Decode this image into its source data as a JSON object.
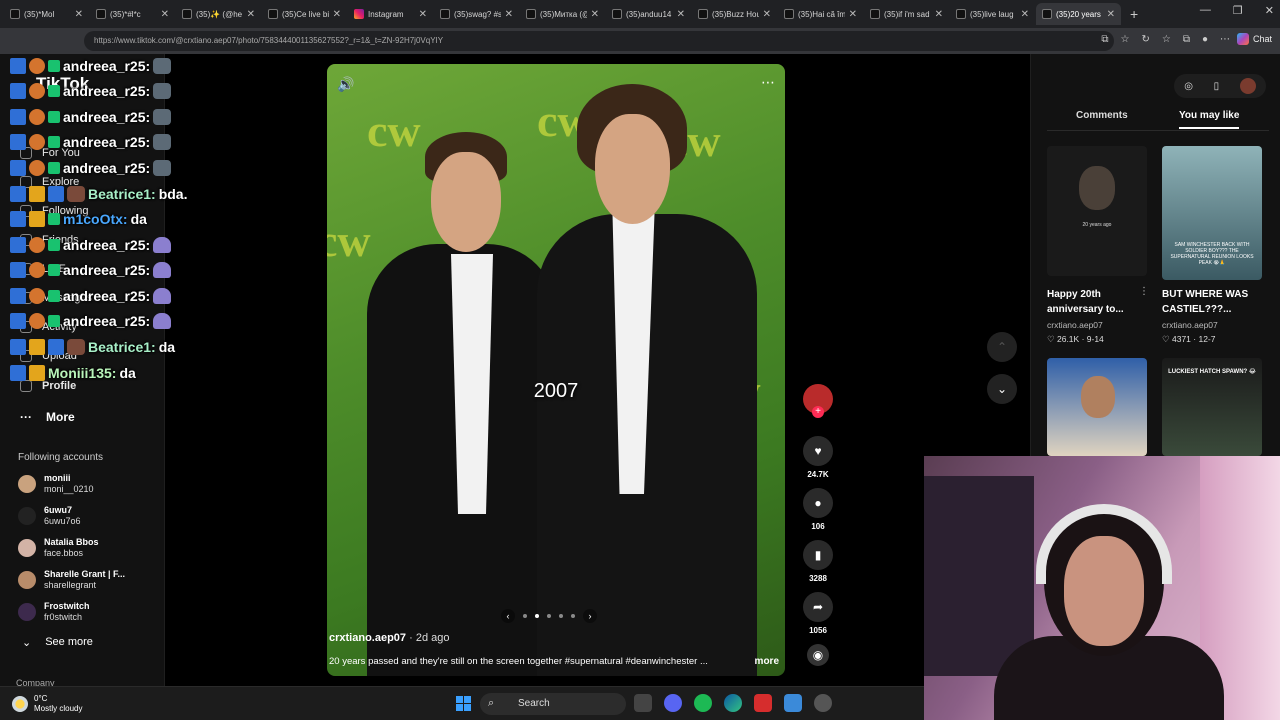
{
  "browser": {
    "tabs": [
      {
        "label": "(35)*Mol"
      },
      {
        "label": "(35)*#l*c"
      },
      {
        "label": "(35)✨ (@he"
      },
      {
        "label": "(35)Ce live bi"
      },
      {
        "label": "Instagram"
      },
      {
        "label": "(35)swag? #s"
      },
      {
        "label": "(35)Митка (@"
      },
      {
        "label": "(35)anduu14"
      },
      {
        "label": "(35)Buzz Hou"
      },
      {
        "label": "(35)Hai că îm"
      },
      {
        "label": "(35)if i'm sad"
      },
      {
        "label": "(35)live laug"
      },
      {
        "label": "(35)20 years"
      }
    ],
    "new_tab": "+",
    "url": "https://www.tiktok.com/@crxtiano.aep07/photo/7583444001135627552?_r=1&_t=ZN-92H7j0VqYIY",
    "chat_label": "Chat"
  },
  "sidebar": {
    "logo": "TikTok",
    "nav": [
      "For You",
      "Explore",
      "Following",
      "Friends",
      "LIVE",
      "Messages",
      "Activity",
      "Upload",
      "Profile"
    ],
    "more": "More",
    "following_header": "Following accounts",
    "accounts": [
      {
        "name": "moniii",
        "handle": "moni__0210"
      },
      {
        "name": "6uwu7",
        "handle": "6uwu7o6"
      },
      {
        "name": "Natalia Bbos",
        "handle": "face.bbos"
      },
      {
        "name": "Sharelle Grant | F...",
        "handle": "sharellegrant"
      },
      {
        "name": "Frostwitch",
        "handle": "fr0stwitch"
      }
    ],
    "see_more": "See more",
    "company": "Company"
  },
  "chat": [
    {
      "user": "andreea_r25:",
      "msg": ""
    },
    {
      "user": "andreea_r25:",
      "msg": ""
    },
    {
      "user": "andreea_r25:",
      "msg": ""
    },
    {
      "user": "andreea_r25:",
      "msg": ""
    },
    {
      "user": "andreea_r25:",
      "msg": ""
    },
    {
      "user": "Beatrice1:",
      "msg": "bda."
    },
    {
      "user": "m1coOtx:",
      "msg": "da"
    },
    {
      "user": "andreea_r25:",
      "msg": ""
    },
    {
      "user": "andreea_r25:",
      "msg": ""
    },
    {
      "user": "andreea_r25:",
      "msg": ""
    },
    {
      "user": "andreea_r25:",
      "msg": ""
    },
    {
      "user": "Beatrice1:",
      "msg": "da"
    },
    {
      "user": "Moniii135:",
      "msg": "da"
    }
  ],
  "video": {
    "overlay_text": "2007",
    "author": "crxtiano.aep07",
    "posted": " · 2d ago",
    "caption": "20 years passed and they're still on the screen  together #supernatural #deanwinchester ...",
    "caption_more": "more"
  },
  "actions": {
    "likes": "24.7K",
    "comments": "106",
    "saves": "3288",
    "shares": "1056"
  },
  "right_panel": {
    "tab_comments": "Comments",
    "tab_you_may_like": "You may like",
    "items": [
      {
        "title": "Happy 20th anniversary to...",
        "user": "crxtiano.aep07",
        "likes": "26.1K",
        "date": "9-14",
        "thumb_text": "20 years ago"
      },
      {
        "title": "BUT WHERE WAS CASTIEL???...",
        "user": "crxtiano.aep07",
        "likes": "4371",
        "date": "12-7",
        "thumb_text": "SAM WINCHESTER BACK WITH SOLDIER BOY??? THE SUPERNATURAL REUNION LOOKS PEAK 😭🙏"
      },
      {
        "title": "",
        "user": "",
        "likes": "",
        "date": "",
        "thumb_text": ""
      },
      {
        "title": "",
        "user": "",
        "likes": "",
        "date": "",
        "thumb_text": "LUCKIEST HATCH SPAWN? 😂"
      }
    ]
  },
  "taskbar": {
    "temp": "0°C",
    "weather": "Mostly cloudy",
    "search": "Search"
  },
  "colors": {
    "accent": "#fe2c55",
    "chat_user_white": "#ffffff",
    "chat_user_mint": "#a8f0c8",
    "chat_user_blue": "#4aa8ff"
  }
}
